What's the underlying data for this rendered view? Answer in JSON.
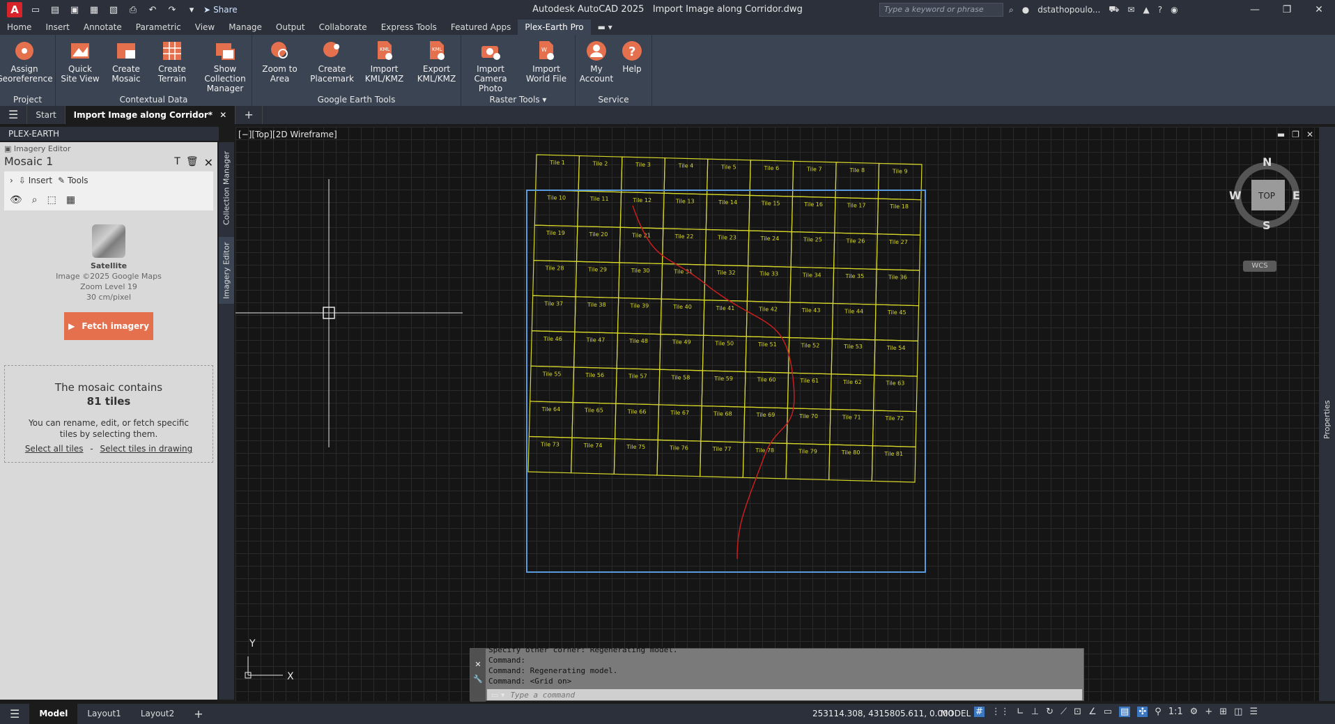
{
  "app": {
    "title": "Autodesk AutoCAD 2025",
    "document": "Import Image along Corridor.dwg",
    "logo_letter": "A",
    "share_label": "Share",
    "search_placeholder": "Type a keyword or phrase",
    "user_name": "dstathopoulo..."
  },
  "ribbon_tabs": [
    "Home",
    "Insert",
    "Annotate",
    "Parametric",
    "View",
    "Manage",
    "Output",
    "Collaborate",
    "Express Tools",
    "Featured Apps",
    "Plex-Earth Pro"
  ],
  "ribbon": {
    "project": {
      "label": "Project",
      "buttons": [
        "Assign\nGeoreference"
      ]
    },
    "contextual": {
      "label": "Contextual Data",
      "buttons": [
        "Quick\nSite View",
        "Create\nMosaic",
        "Create\nTerrain",
        "Show Collection\nManager"
      ]
    },
    "google": {
      "label": "Google Earth Tools",
      "buttons": [
        "Zoom to\nArea",
        "Create\nPlacemark",
        "Import\nKML/KMZ",
        "Export\nKML/KMZ"
      ]
    },
    "raster": {
      "label": "Raster Tools",
      "buttons": [
        "Import\nCamera Photo",
        "Import\nWorld File"
      ]
    },
    "service": {
      "label": "Service",
      "buttons": [
        "My\nAccount",
        "Help"
      ]
    }
  },
  "doc_tabs": {
    "start": "Start",
    "active": "Import Image along Corridor*"
  },
  "palette": {
    "title": "PLEX-EARTH",
    "editor_label": "Imagery Editor",
    "mosaic_name": "Mosaic 1",
    "insert_label": "Insert",
    "tools_label": "Tools",
    "provider": "Satellite",
    "copyright": "Image ©2025 Google Maps",
    "zoom": "Zoom Level 19",
    "resolution": "30 cm/pixel",
    "fetch_label": "Fetch imagery",
    "info_line1": "The mosaic contains",
    "info_count": "81 tiles",
    "info_desc": "You can rename, edit, or fetch specific tiles by selecting them.",
    "link_all": "Select all tiles",
    "link_sep": "-",
    "link_drawing": "Select tiles in drawing",
    "vtab_collection": "Collection Manager",
    "vtab_editor": "Imagery Editor"
  },
  "viewport": {
    "label": "[−][Top][2D Wireframe]",
    "compass": {
      "n": "N",
      "s": "S",
      "e": "E",
      "w": "W",
      "top": "TOP"
    },
    "wcs": "WCS",
    "ucs_x": "X",
    "ucs_y": "Y",
    "tile_prefix": "Tile ",
    "tile_rows": 9,
    "tile_cols": 9
  },
  "properties_label": "Properties",
  "command": {
    "history": [
      "Specify other corner: Regenerating model.",
      "Command:",
      "Command: Regenerating model.",
      "Command:  <Grid on>"
    ],
    "placeholder": "Type a command"
  },
  "status": {
    "model_tab": "Model",
    "layout1": "Layout1",
    "layout2": "Layout2",
    "coords": "253114.308, 4315805.611, 0.000",
    "mode": "MODEL",
    "scale": "1:1"
  },
  "colors": {
    "accent_orange": "#e5704d",
    "tile_line": "#d8d82a",
    "route_line": "#c81e1e",
    "selection_blue": "#5a9be0"
  }
}
